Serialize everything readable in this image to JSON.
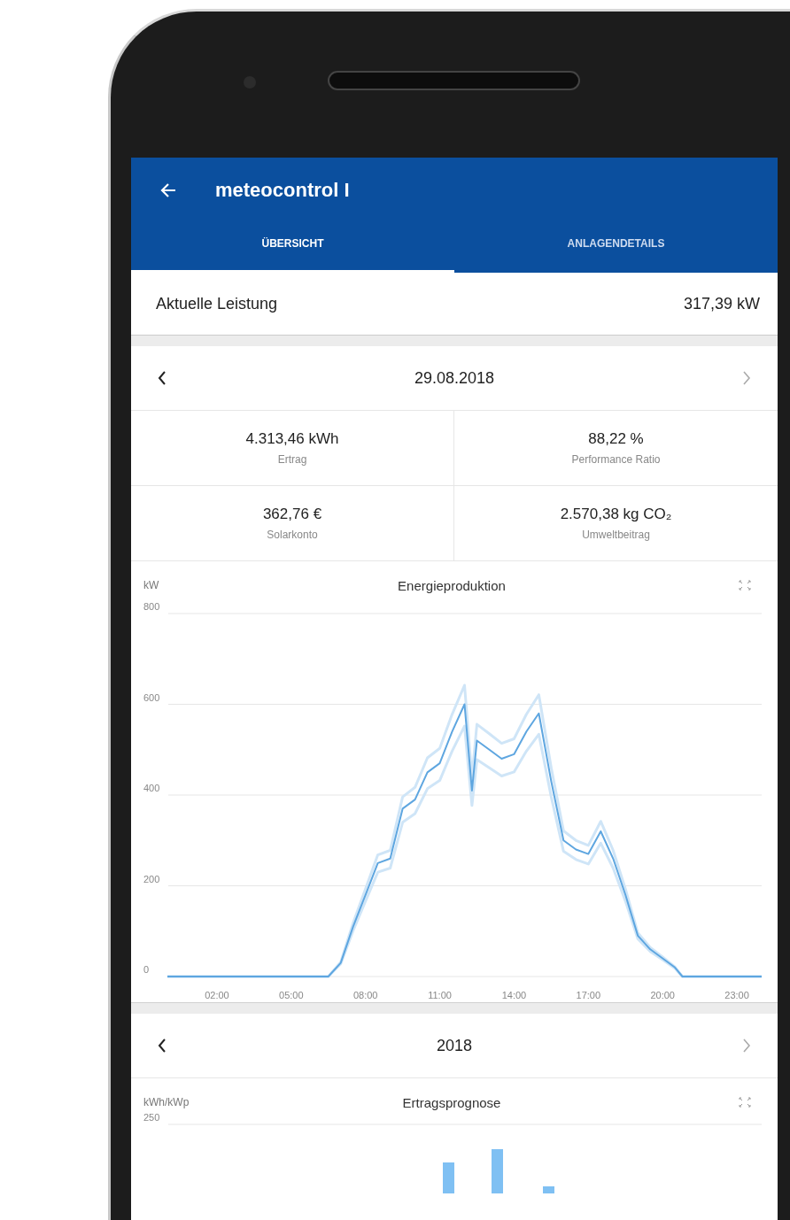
{
  "app_bar": {
    "title": "meteocontrol I"
  },
  "tabs": [
    {
      "label": "ÜBERSICHT",
      "selected": true
    },
    {
      "label": "ANLAGENDETAILS",
      "selected": false
    }
  ],
  "current_power": {
    "label": "Aktuelle Leistung",
    "value": "317,39 kW"
  },
  "day_card": {
    "nav": {
      "label": "29.08.2018",
      "next_enabled": false
    },
    "stats": [
      {
        "value": "4.313,46 kWh",
        "label": "Ertrag"
      },
      {
        "value": "88,22 %",
        "label": "Performance Ratio"
      },
      {
        "value": "362,76 €",
        "label": "Solarkonto"
      },
      {
        "value": "2.570,38 kg CO₂",
        "label": "Umweltbeitrag"
      }
    ],
    "chart_data": {
      "type": "line",
      "title": "Energieproduktion",
      "ylabel": "kW",
      "grid": true,
      "xlim": [
        0,
        24
      ],
      "ylim": [
        0,
        800
      ],
      "x": [
        0,
        6.5,
        7,
        7.5,
        8,
        8.5,
        9,
        9.5,
        10,
        10.5,
        11,
        11.5,
        12,
        12.3,
        12.5,
        13,
        13.5,
        14,
        14.5,
        15,
        15.5,
        16,
        16.5,
        17,
        17.5,
        18,
        18.5,
        19,
        19.5,
        20,
        20.5,
        20.8,
        24
      ],
      "series": [
        {
          "color": "#5ea6e0",
          "values": [
            0,
            0,
            30,
            110,
            180,
            250,
            260,
            370,
            390,
            450,
            470,
            540,
            600,
            410,
            520,
            500,
            480,
            490,
            540,
            580,
            430,
            300,
            280,
            270,
            320,
            260,
            180,
            90,
            60,
            40,
            20,
            0,
            0
          ]
        },
        {
          "color": "#cfe5f7",
          "values": [
            0,
            0,
            32,
            118,
            193,
            268,
            278,
            396,
            417,
            482,
            503,
            578,
            642,
            439,
            556,
            535,
            514,
            524,
            578,
            621,
            460,
            321,
            300,
            289,
            342,
            278,
            193,
            96,
            64,
            43,
            21,
            0,
            0
          ]
        },
        {
          "color": "#cfe5f7",
          "values": [
            0,
            0,
            28,
            101,
            166,
            230,
            239,
            340,
            359,
            414,
            432,
            497,
            552,
            377,
            478,
            460,
            442,
            451,
            497,
            534,
            396,
            276,
            258,
            248,
            294,
            239,
            166,
            83,
            55,
            37,
            18,
            0,
            0
          ]
        }
      ],
      "yticks": [
        0,
        200,
        400,
        600,
        800
      ],
      "xticks": [
        {
          "value": 2,
          "label": "02:00"
        },
        {
          "value": 5,
          "label": "05:00"
        },
        {
          "value": 8,
          "label": "08:00"
        },
        {
          "value": 11,
          "label": "11:00"
        },
        {
          "value": 14,
          "label": "14:00"
        },
        {
          "value": 17,
          "label": "17:00"
        },
        {
          "value": 20,
          "label": "20:00"
        },
        {
          "value": 23,
          "label": "23:00"
        }
      ]
    }
  },
  "year_card": {
    "nav": {
      "label": "2018",
      "next_enabled": false
    },
    "chart": {
      "title": "Ertragsprognose",
      "unit": "kWh/kWp",
      "top_tick": "250"
    }
  }
}
